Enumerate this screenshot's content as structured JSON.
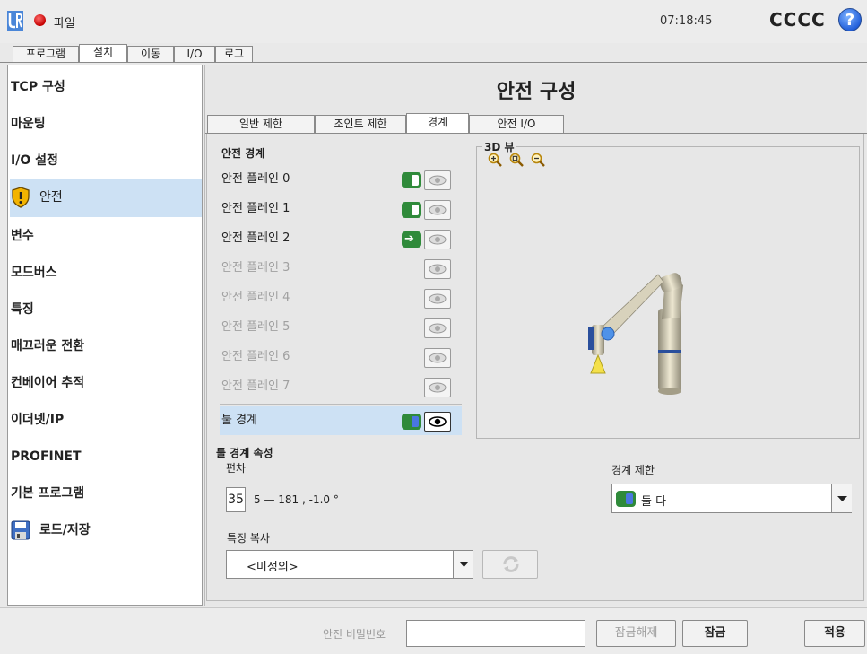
{
  "topbar": {
    "file_label": "파일",
    "clock": "07:18:45",
    "robot_name": "CCCC",
    "help": "?"
  },
  "main_tabs": [
    "프로그램",
    "설치",
    "이동",
    "I/O",
    "로그"
  ],
  "sidebar": {
    "items": [
      {
        "label": "TCP 구성"
      },
      {
        "label": "마운팅"
      },
      {
        "label": "I/O 설정"
      },
      {
        "label": "안전"
      },
      {
        "label": "변수"
      },
      {
        "label": "모드버스"
      },
      {
        "label": "특징"
      },
      {
        "label": "매끄러운 전환"
      },
      {
        "label": "컨베이어 추적"
      },
      {
        "label": "이더넷/IP"
      },
      {
        "label": "PROFINET"
      },
      {
        "label": "기본 프로그램"
      },
      {
        "label": "로드/저장"
      }
    ]
  },
  "content": {
    "title": "안전 구성",
    "subtabs": [
      "일반 제한",
      "조인트 제한",
      "경계",
      "안전 I/O"
    ],
    "boundaries_label": "안전 경계",
    "view3d_label": "3D 뷰",
    "planes": [
      {
        "label": "안전 플레인 0"
      },
      {
        "label": "안전 플레인 1"
      },
      {
        "label": "안전 플레인 2"
      },
      {
        "label": "안전 플레인 3"
      },
      {
        "label": "안전 플레인 4"
      },
      {
        "label": "안전 플레인 5"
      },
      {
        "label": "안전 플레인 6"
      },
      {
        "label": "안전 플레인 7"
      },
      {
        "label": "툴 경계"
      }
    ],
    "tool_props_label": "툴 경계 속성",
    "deviation_label": "편차",
    "deviation_value": "35",
    "deviation_range": "5 — 181 , -1.0 °",
    "limit_label": "경계 제한",
    "limit_value": "둘 다",
    "copy_feature_label": "특징 복사",
    "copy_feature_value": "<미정의>"
  },
  "bottom": {
    "password_label": "안전 비밀번호",
    "unlock_label": "잠금해제",
    "lock_label": "잠금",
    "apply_label": "적용"
  },
  "colors": {
    "accent_green": "#2f8a3a",
    "selection": "#cde1f4",
    "power": "#c40000"
  }
}
